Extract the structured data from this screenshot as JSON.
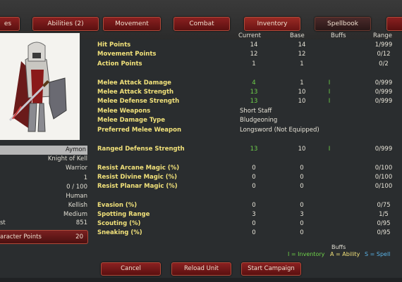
{
  "tabs": [
    {
      "label": "es"
    },
    {
      "label": "Abilities (2)"
    },
    {
      "label": "Movement"
    },
    {
      "label": "Combat"
    },
    {
      "label": "Inventory"
    },
    {
      "label": "Spellbook"
    }
  ],
  "columns": {
    "current": "Current",
    "base": "Base",
    "buffs": "Buffs",
    "range": "Range"
  },
  "character": {
    "name": "Aymon",
    "rows": [
      {
        "label": "",
        "value": "Knight of Kell"
      },
      {
        "label": "",
        "value": "Warrior"
      },
      {
        "label": "",
        "value": "1"
      },
      {
        "label": "",
        "value": "0 / 100"
      },
      {
        "label": "",
        "value": "Human"
      },
      {
        "label": "",
        "value": "Kellish"
      },
      {
        "label": "",
        "value": "Medium"
      },
      {
        "label": "st",
        "value": "851"
      }
    ],
    "points_label": "aracter Points",
    "points_value": "20"
  },
  "stats": [
    {
      "label": "Hit Points",
      "current": "14",
      "base": "14",
      "buff": "",
      "range": "1/999"
    },
    {
      "label": "Movement Points",
      "current": "12",
      "base": "12",
      "buff": "",
      "range": "0/12"
    },
    {
      "label": "Action Points",
      "current": "1",
      "base": "1",
      "buff": "",
      "range": "0/2"
    },
    {
      "label": "Melee Attack Damage",
      "current": "4",
      "base": "1",
      "buff": "I",
      "range": "0/999",
      "green": true
    },
    {
      "label": "Melee Attack Strength",
      "current": "13",
      "base": "10",
      "buff": "I",
      "range": "0/999",
      "green": true
    },
    {
      "label": "Melee Defense Strength",
      "current": "13",
      "base": "10",
      "buff": "I",
      "range": "0/999",
      "green": true
    },
    {
      "label": "Melee Weapons",
      "text": "Short Staff"
    },
    {
      "label": "Melee Damage Type",
      "text": "Bludgeoning"
    },
    {
      "label": "Preferred Melee Weapon",
      "text": "Longsword (Not Equipped)"
    },
    {
      "label": "Ranged Defense Strength",
      "current": "13",
      "base": "10",
      "buff": "I",
      "range": "0/999",
      "green": true
    },
    {
      "label": "Resist Arcane Magic (%)",
      "current": "0",
      "base": "0",
      "buff": "",
      "range": "0/100"
    },
    {
      "label": "Resist Divine Magic (%)",
      "current": "0",
      "base": "0",
      "buff": "",
      "range": "0/100"
    },
    {
      "label": "Resist Planar Magic (%)",
      "current": "0",
      "base": "0",
      "buff": "",
      "range": "0/100"
    },
    {
      "label": "Evasion (%)",
      "current": "0",
      "base": "0",
      "buff": "",
      "range": "0/75"
    },
    {
      "label": "Spotting Range",
      "current": "3",
      "base": "3",
      "buff": "",
      "range": "1/5"
    },
    {
      "label": "Scouting (%)",
      "current": "0",
      "base": "0",
      "buff": "",
      "range": "0/95"
    },
    {
      "label": "Sneaking (%)",
      "current": "0",
      "base": "0",
      "buff": "",
      "range": "0/95"
    }
  ],
  "legend": {
    "title": "Buffs",
    "inventory": "I = Inventory",
    "ability": "A = Ability",
    "spell": "S = Spell"
  },
  "buttons": {
    "cancel": "Cancel",
    "reload": "Reload Unit",
    "start": "Start Campaign"
  },
  "colors": {
    "label": "#f2e27a",
    "buffed": "#6fd34a",
    "ability": "#f2e27a",
    "spell": "#5ab4e8",
    "inventory": "#6fd34a"
  }
}
